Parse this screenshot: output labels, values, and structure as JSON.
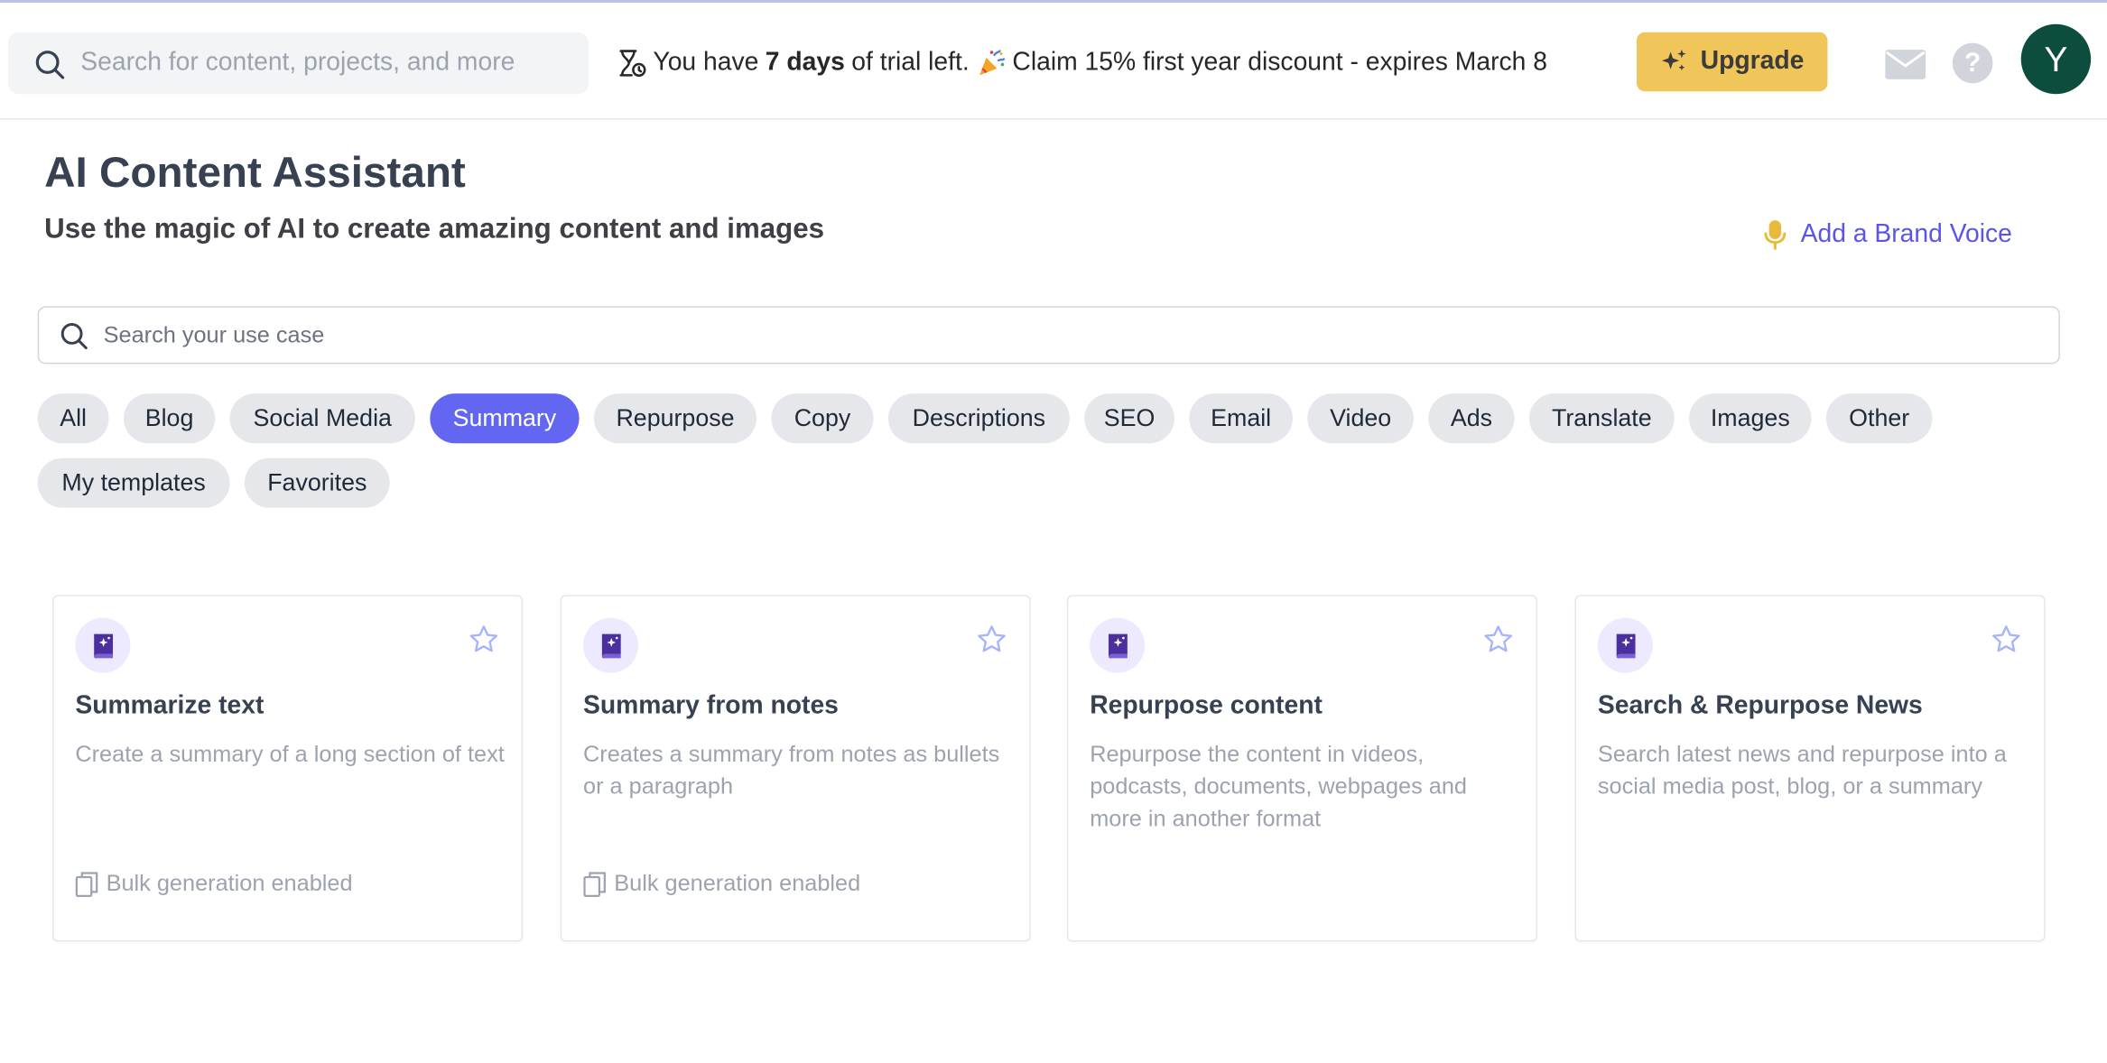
{
  "topbar": {
    "search_placeholder": "Search for content, projects, and more",
    "trial": {
      "prefix": "You have",
      "days": "7 days",
      "suffix": "of trial left.",
      "offer": "Claim 15% first year discount - expires March 8"
    },
    "upgrade_label": "Upgrade",
    "help_label": "?",
    "avatar_initial": "Y"
  },
  "header": {
    "title": "AI Content Assistant",
    "subtitle": "Use the magic of AI to create amazing content and images",
    "brand_voice_label": "Add a Brand Voice"
  },
  "usecase_search": {
    "placeholder": "Search your use case"
  },
  "filters": {
    "active": "Summary",
    "items": [
      "All",
      "Blog",
      "Social Media",
      "Summary",
      "Repurpose",
      "Copy",
      "Descriptions",
      "SEO",
      "Email",
      "Video",
      "Ads",
      "Translate",
      "Images",
      "Other",
      "My templates",
      "Favorites"
    ]
  },
  "cards": [
    {
      "title": "Summarize text",
      "description": "Create a summary of a long section of text",
      "bulk": "Bulk generation enabled"
    },
    {
      "title": "Summary from notes",
      "description": "Creates a summary from notes as bullets or a paragraph",
      "bulk": "Bulk generation enabled"
    },
    {
      "title": "Repurpose content",
      "description": "Repurpose the content in videos, podcasts, documents, webpages and more in another format",
      "bulk": ""
    },
    {
      "title": "Search & Repurpose News",
      "description": "Search latest news and repurpose into a social media post, blog, or a summary",
      "bulk": ""
    }
  ],
  "colors": {
    "accent": "#6366f1",
    "upgrade": "#f0c55a",
    "avatar": "#0c4d3e",
    "link": "#5a55e6",
    "card_icon": "#4c2f9e",
    "card_icon_bg": "#ede9fe",
    "star": "#a5b4fc",
    "mic": "#e9b93a"
  },
  "icons": {
    "global_search": "search-icon",
    "trial": "hourglass-icon",
    "offer": "party-popper-icon",
    "upgrade": "sparkles-icon",
    "mail": "mail-icon",
    "help": "help-icon",
    "brand_voice": "microphone-icon",
    "card": "magic-book-icon",
    "favorite": "star-icon",
    "bulk": "copy-icon"
  }
}
